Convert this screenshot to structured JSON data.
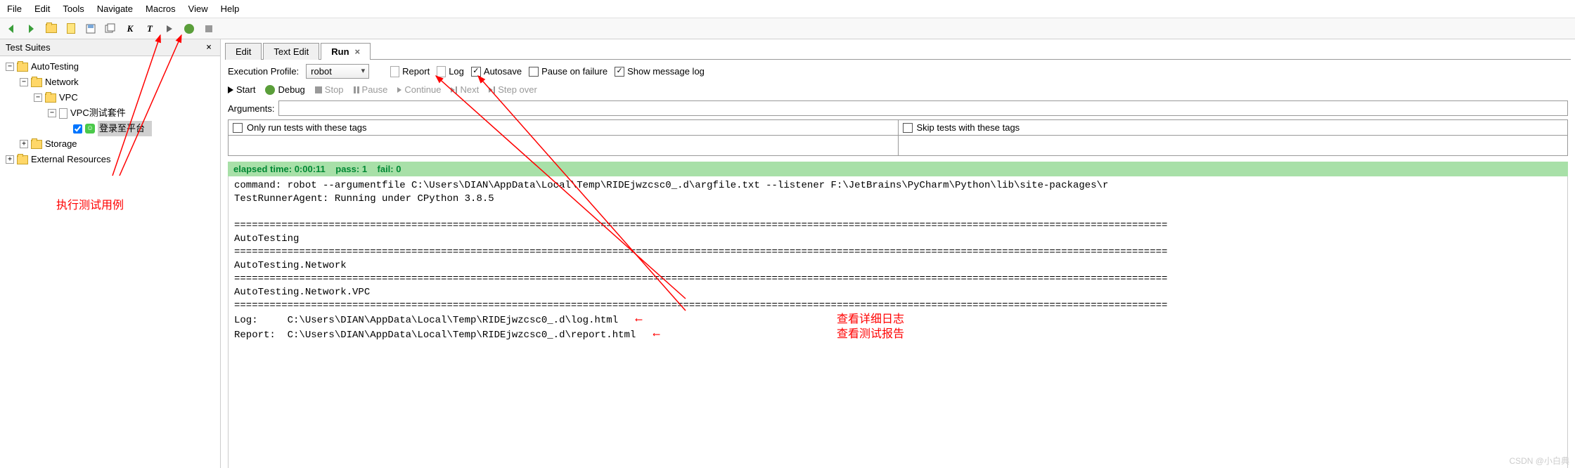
{
  "menu": [
    "File",
    "Edit",
    "Tools",
    "Navigate",
    "Macros",
    "View",
    "Help"
  ],
  "sidebar": {
    "title": "Test Suites",
    "tree": {
      "root": "AutoTesting",
      "l1": [
        "Network",
        "Storage"
      ],
      "vpc": "VPC",
      "suite": "VPC测试套件",
      "test": "登录至平台"
    },
    "ext": "External Resources",
    "note": "执行测试用例"
  },
  "tabs": {
    "edit": "Edit",
    "textedit": "Text Edit",
    "run": "Run"
  },
  "run": {
    "profile_label": "Execution Profile:",
    "profile_value": "robot",
    "report": "Report",
    "log": "Log",
    "autosave": "Autosave",
    "pausefail": "Pause on failure",
    "showlog": "Show message log",
    "start": "Start",
    "debug": "Debug",
    "stop": "Stop",
    "pause": "Pause",
    "continue": "Continue",
    "next": "Next",
    "stepover": "Step over",
    "args_label": "Arguments:",
    "onlytags": "Only run tests with these tags",
    "skiptags": "Skip tests with these tags"
  },
  "status": {
    "elapsed": "elapsed time: 0:00:11",
    "pass": "pass: 1",
    "fail": "fail: 0"
  },
  "console": {
    "l1": "command: robot --argumentfile C:\\Users\\DIAN\\AppData\\Local\\Temp\\RIDEjwzcsc0_.d\\argfile.txt --listener F:\\JetBrains\\PyCharm\\Python\\lib\\site-packages\\r",
    "l2": "TestRunnerAgent: Running under CPython 3.8.5",
    "sep": "==============================================================================================================================================================",
    "s1": "AutoTesting",
    "s2": "AutoTesting.Network",
    "s3": "AutoTesting.Network.VPC",
    "loglabel": "Log:     C:\\Users\\DIAN\\AppData\\Local\\Temp\\RIDEjwzcsc0_.d\\log.html",
    "reportlabel": "Report:  C:\\Users\\DIAN\\AppData\\Local\\Temp\\RIDEjwzcsc0_.d\\report.html",
    "note_log": "查看详细日志",
    "note_report": "查看测试报告"
  },
  "watermark": "CSDN @小白典"
}
